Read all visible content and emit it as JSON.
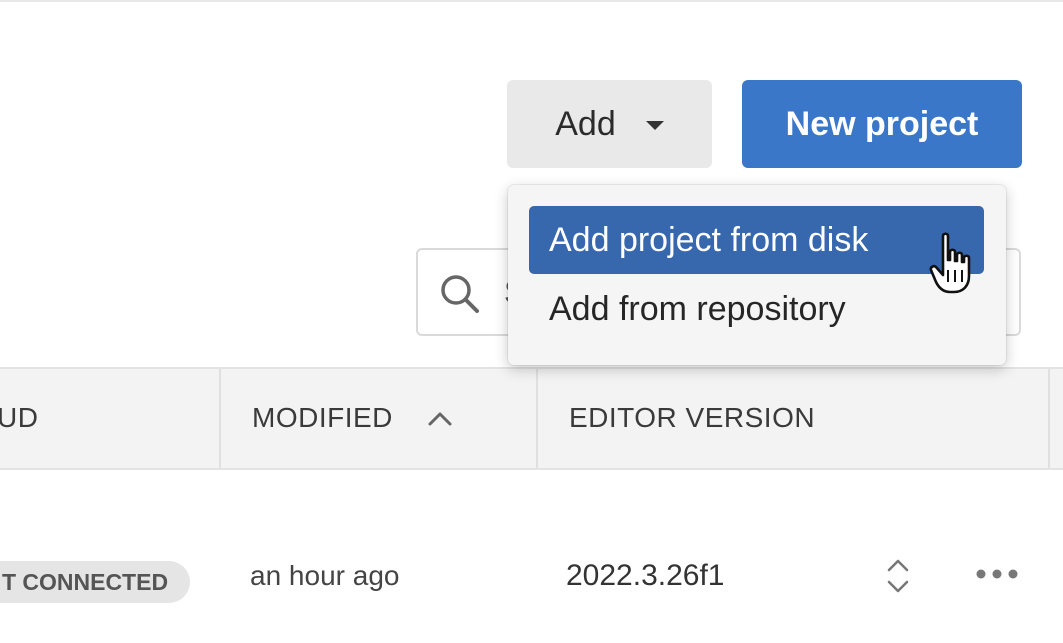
{
  "toolbar": {
    "add_label": "Add",
    "new_project_label": "New project"
  },
  "search": {
    "visible_text": "S"
  },
  "dropdown": {
    "items": [
      {
        "label": "Add project from disk",
        "state": "hovered"
      },
      {
        "label": "Add from repository",
        "state": "normal"
      }
    ]
  },
  "table": {
    "columns": {
      "cloud": "UD",
      "modified": "MODIFIED",
      "editor_version": "EDITOR VERSION"
    },
    "sort": {
      "column": "modified",
      "direction": "ascending"
    },
    "rows": [
      {
        "status": "T CONNECTED",
        "modified": "an hour ago",
        "editor_version": "2022.3.26f1"
      }
    ]
  },
  "colors": {
    "primary": "#3a77c8",
    "hover": "#3767ad",
    "header_bg": "#f3f3f3"
  },
  "icons": {
    "search": "search-icon",
    "caret": "caret-down-icon",
    "sort": "chevron-up-icon",
    "version_select": "chevron-up-down-icon",
    "more": "more-horizontal-icon",
    "cursor": "hand-pointer-icon"
  }
}
